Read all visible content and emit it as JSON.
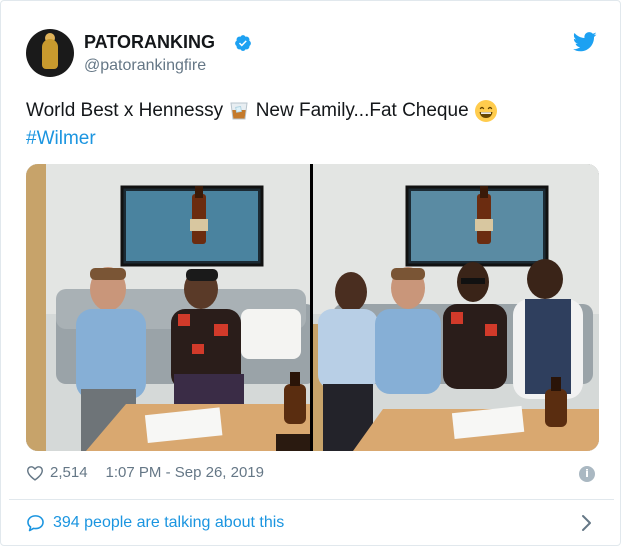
{
  "user": {
    "name": "PATORANKING",
    "handle": "@patorankingfire"
  },
  "tweet": {
    "text_part1": "World Best x Hennessy",
    "text_part2": "New Family...Fat Cheque",
    "hashtag": "#Wilmer",
    "emoji_1": "tumbler-glass",
    "emoji_2": "grinning-face-with-smiling-eyes"
  },
  "meta": {
    "likes": "2,514",
    "timestamp": "1:07 PM - Sep 26, 2019"
  },
  "conversation": {
    "label": "394 people are talking about this"
  },
  "colors": {
    "accent": "#1b95e0",
    "verified": "#1da1f2",
    "secondary_text": "#657786",
    "primary_text": "#14171a"
  },
  "icons": [
    "verified-badge-icon",
    "twitter-bird-icon",
    "heart-icon",
    "info-icon",
    "speech-bubble-icon",
    "chevron-right-icon"
  ]
}
